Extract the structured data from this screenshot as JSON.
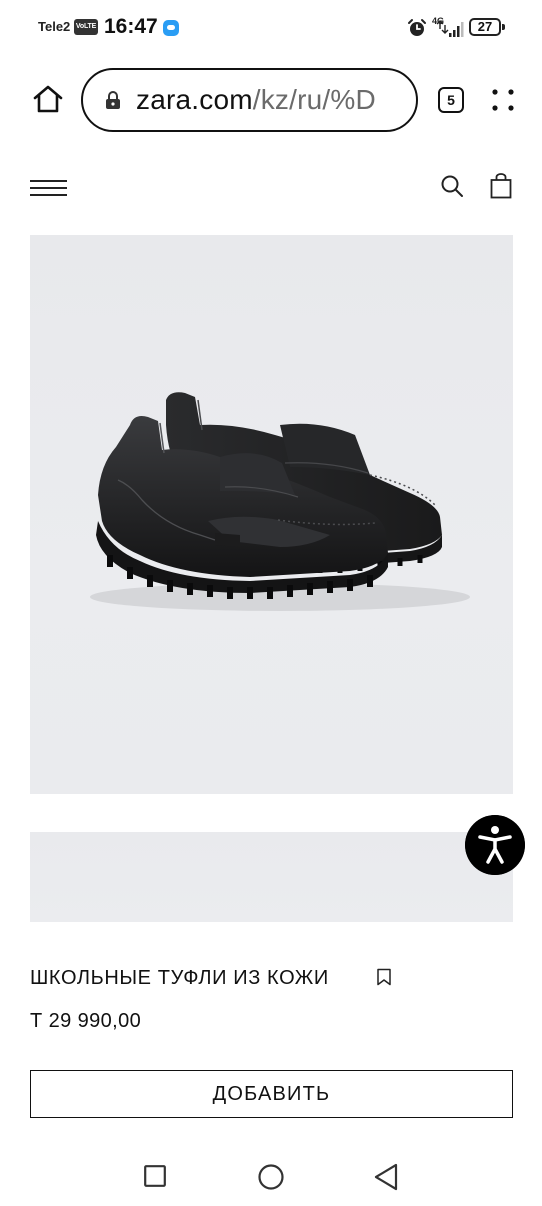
{
  "status_bar": {
    "carrier": "Tele2",
    "volte": "VoLTE",
    "time": "16:47",
    "network": "4G",
    "battery": "27",
    "icons": [
      "message-icon",
      "alarm-icon",
      "signal-icon",
      "battery-icon"
    ]
  },
  "browser": {
    "url_host": "zara.com",
    "url_path": "/kz/ru/%D",
    "tab_count": "5",
    "icons": [
      "home-icon",
      "lock-icon",
      "menu-dots-icon"
    ]
  },
  "site_header": {
    "icons": [
      "hamburger-icon",
      "search-icon",
      "shopping-bag-icon"
    ]
  },
  "product": {
    "name": "ШКОЛЬНЫЕ ТУФЛИ ИЗ КОЖИ",
    "price": "Т 29 990,00",
    "add_button_label": "ДОБАВИТЬ",
    "image_alt": "black leather loafers"
  },
  "accessibility": {
    "icon": "accessibility-icon"
  },
  "nav_bar": {
    "icons": [
      "recent-apps-icon",
      "home-circle-icon",
      "back-icon"
    ]
  },
  "colors": {
    "image_bg": "#e9eaed",
    "text": "#111111",
    "url_path": "#6b6b6b",
    "accessibility_bg": "#000000"
  }
}
